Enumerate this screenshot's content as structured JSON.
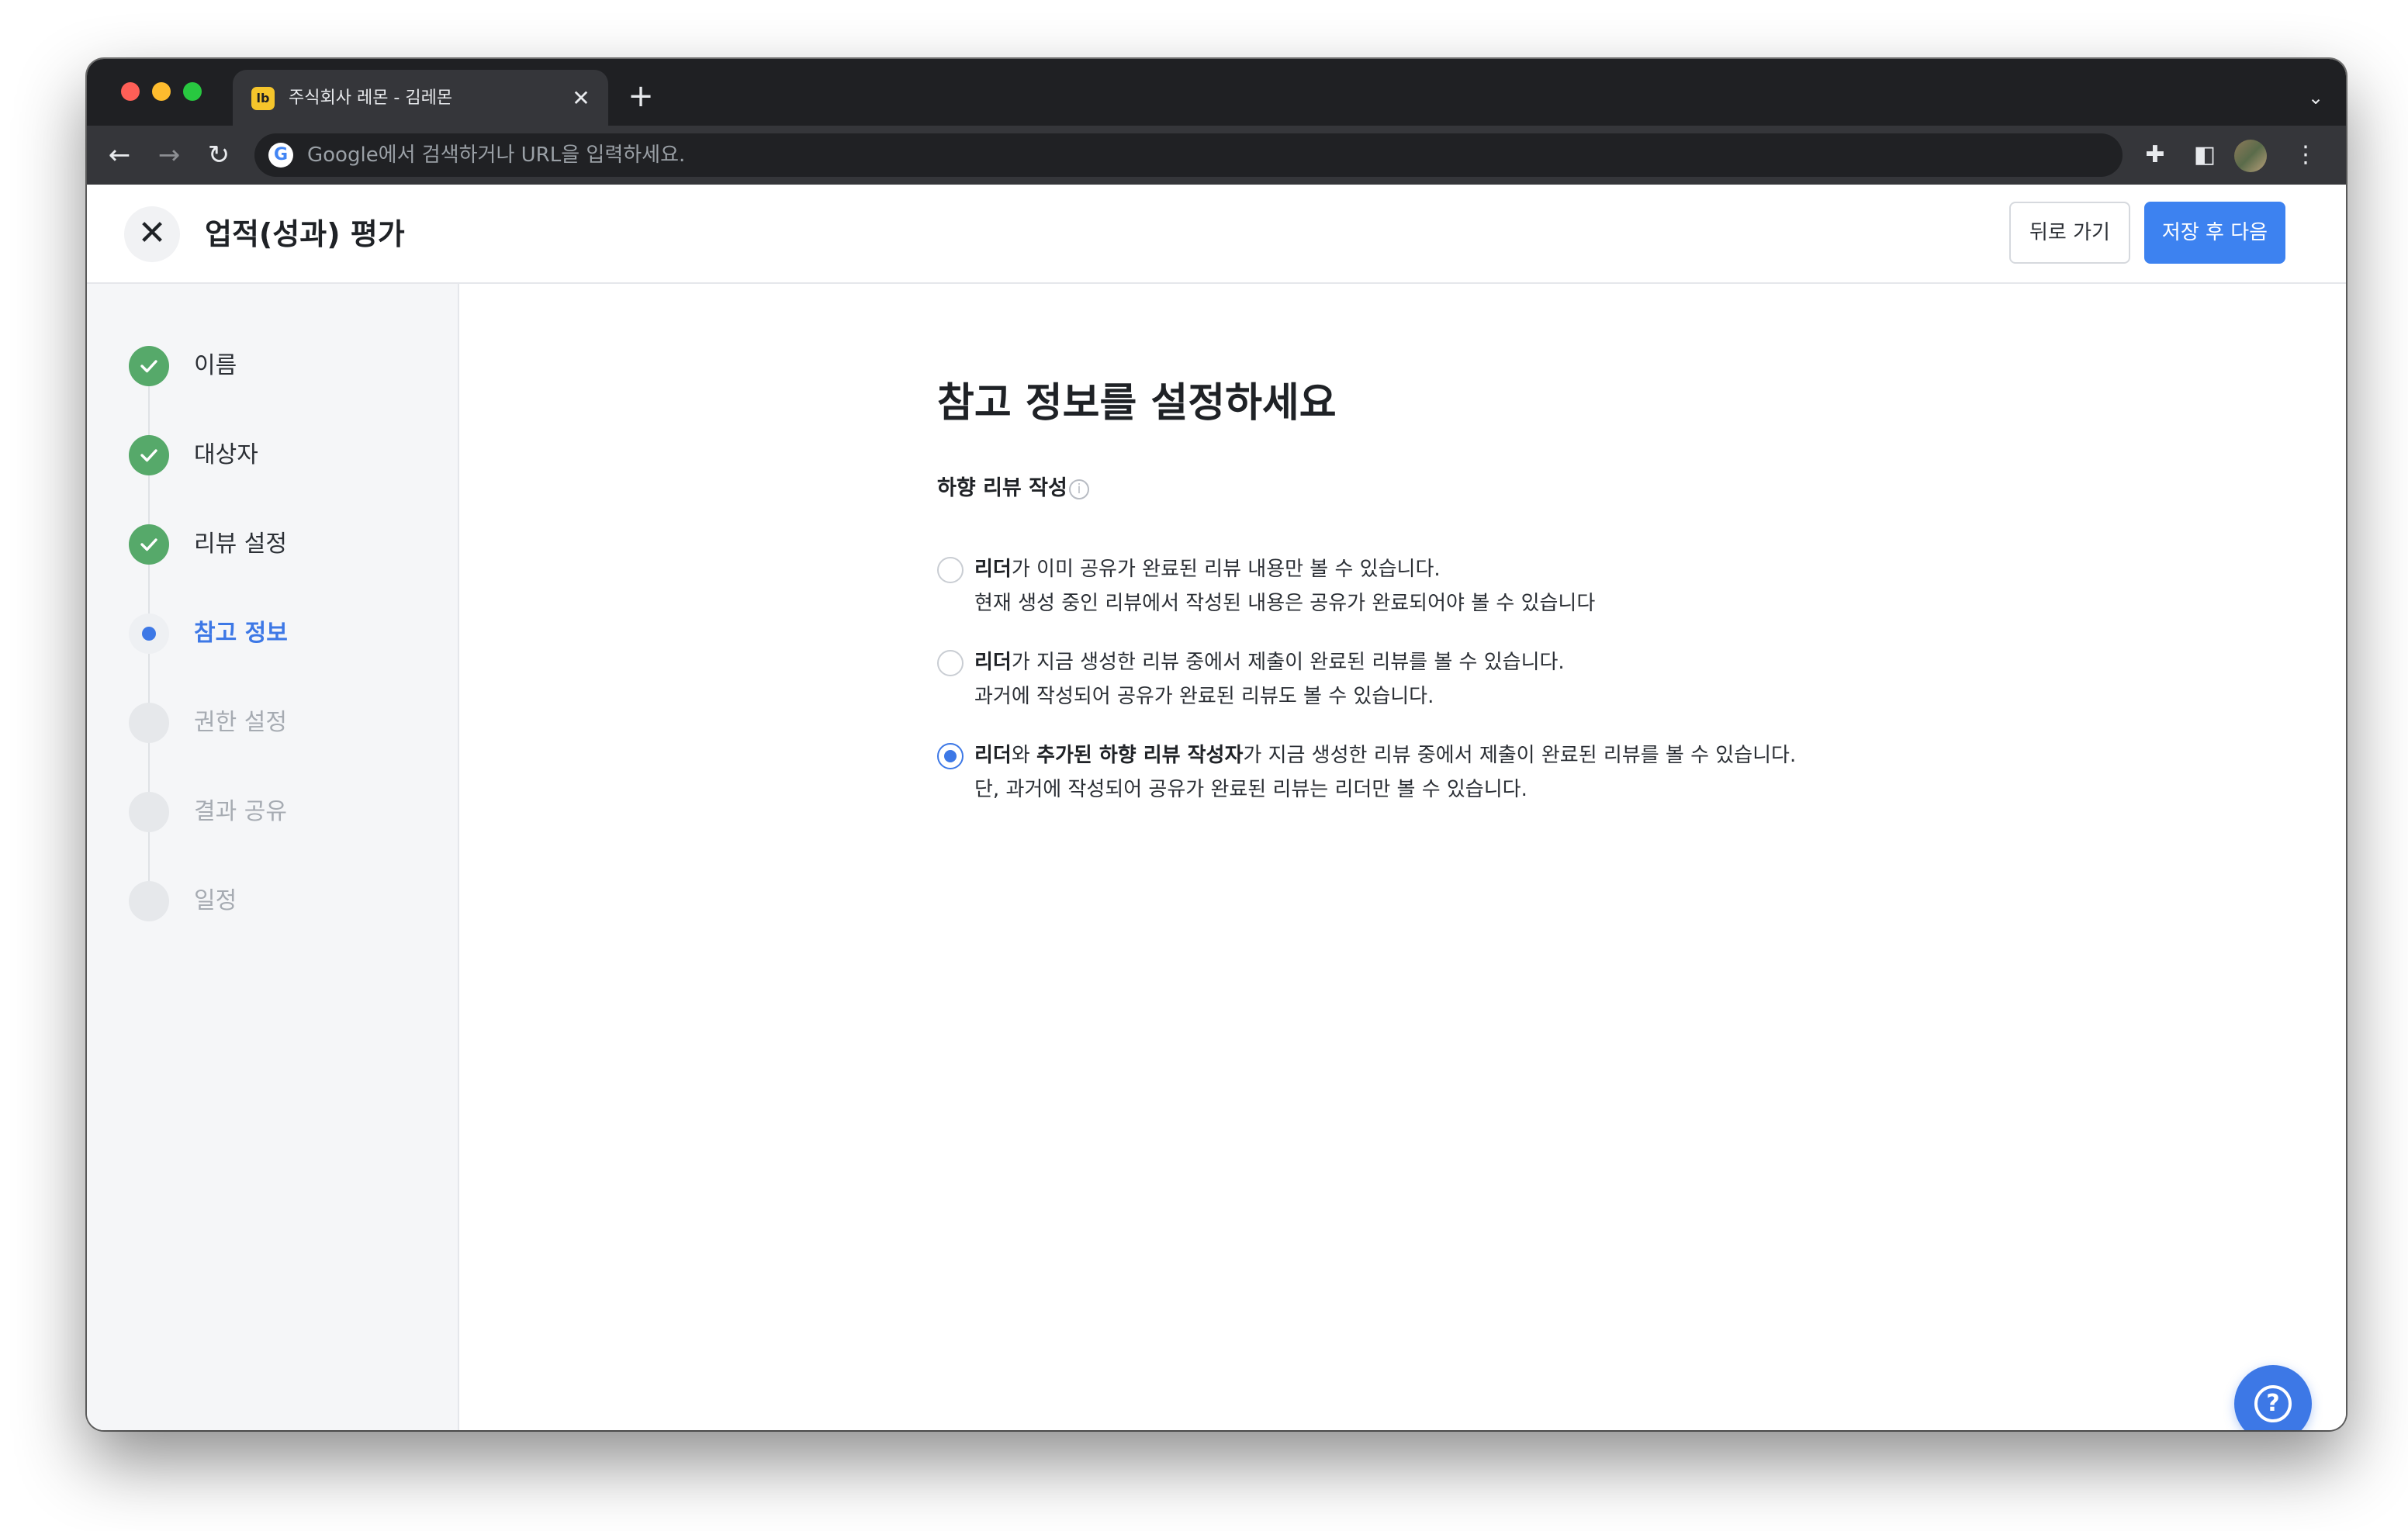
{
  "browser": {
    "tab_title": "주식회사 레몬 - 김레몬",
    "tab_favicon": "lb",
    "tab_close": "✕",
    "new_tab": "+",
    "tab_menu": "⌄",
    "omnibox_placeholder": "Google에서 검색하거나 URL을 입력하세요.",
    "google_glyph": "G",
    "nav_back": "←",
    "nav_forward": "→",
    "nav_reload": "↻",
    "extensions": "✚",
    "side_panel": "◧",
    "more": "⋮"
  },
  "header": {
    "close_glyph": "✕",
    "title": "업적(성과) 평가",
    "back_label": "뒤로 가기",
    "next_label": "저장 후 다음"
  },
  "sidebar": {
    "steps": [
      {
        "label": "이름",
        "state": "done"
      },
      {
        "label": "대상자",
        "state": "done"
      },
      {
        "label": "리뷰 설정",
        "state": "done"
      },
      {
        "label": "참고 정보",
        "state": "current"
      },
      {
        "label": "권한 설정",
        "state": "todo"
      },
      {
        "label": "결과 공유",
        "state": "todo"
      },
      {
        "label": "일정",
        "state": "todo"
      }
    ]
  },
  "main": {
    "heading": "참고 정보를 설정하세요",
    "section_label": "하향 리뷰 작성",
    "info_glyph": "i",
    "options": [
      {
        "bold1": "리더",
        "text1": "가 이미 공유가 완료된 리뷰 내용만 볼 수 있습니다.",
        "line2": "현재 생성 중인 리뷰에서 작성된 내용은 공유가 완료되어야 볼 수 있습니다",
        "selected": false
      },
      {
        "bold1": "리더",
        "text1": "가 지금 생성한 리뷰 중에서 제출이 완료된 리뷰를 볼 수 있습니다.",
        "line2": "과거에 작성되어 공유가 완료된 리뷰도 볼 수 있습니다.",
        "selected": false
      },
      {
        "bold1": "리더",
        "text1": "와 ",
        "bold2": "추가된 하향 리뷰 작성자",
        "text2": "가 지금 생성한 리뷰 중에서 제출이 완료된 리뷰를 볼 수 있습니다.",
        "line2": "단, 과거에 작성되어 공유가 완료된 리뷰는 리더만 볼 수 있습니다.",
        "selected": true
      }
    ],
    "help_glyph": "?"
  },
  "colors": {
    "accent": "#3d78e6",
    "done": "#56a96a",
    "sidebar_bg": "#f5f6f8"
  }
}
